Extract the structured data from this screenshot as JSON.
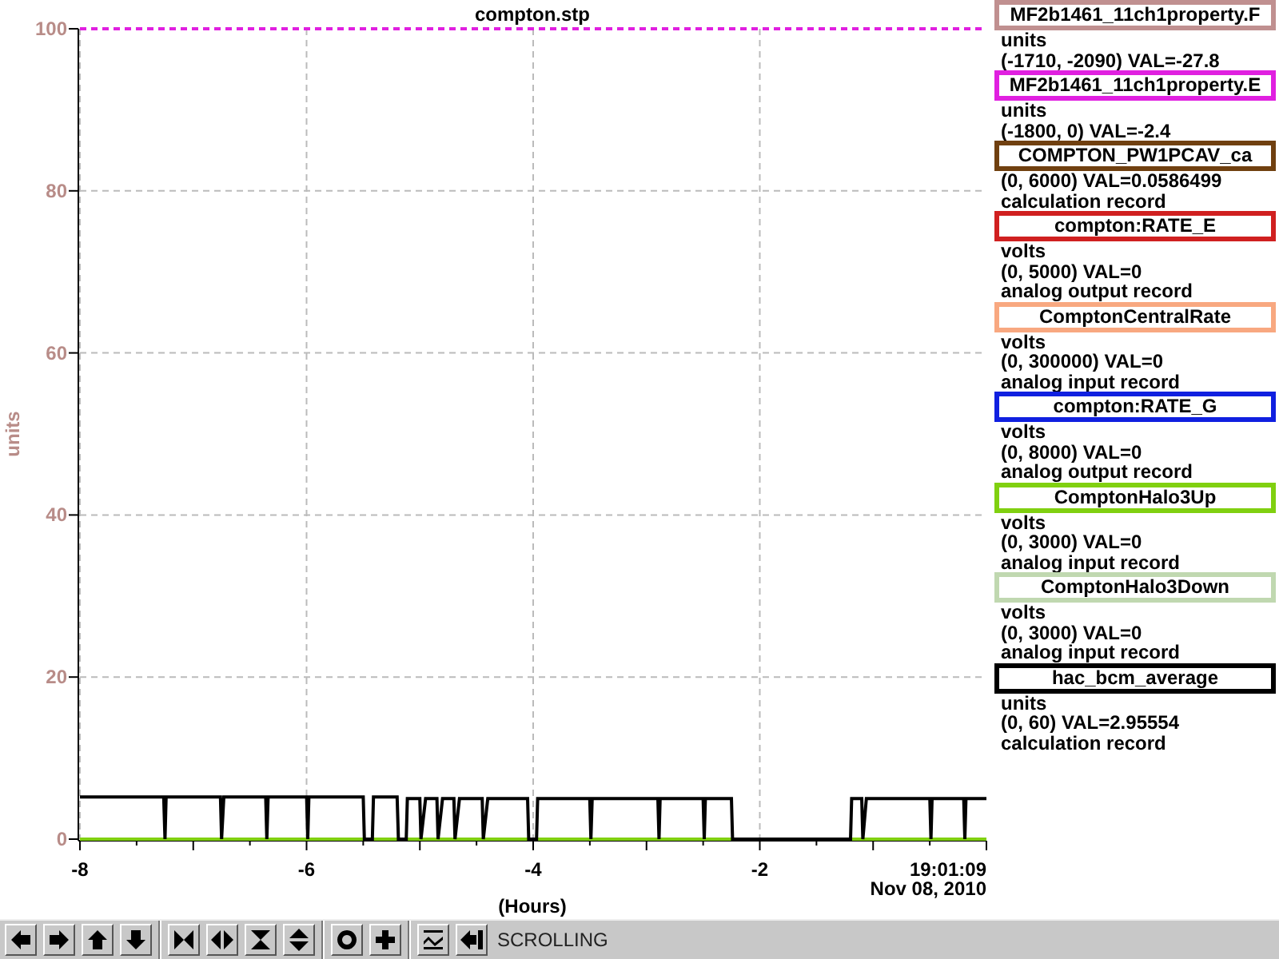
{
  "chart": {
    "title": "compton.stp",
    "y_axis_label": "units",
    "end_time": "19:01:09",
    "end_date": "Nov 08, 2010",
    "chart_data": {
      "type": "line",
      "grid": true,
      "xlabel": "(Hours)",
      "xlim": [
        -8,
        0
      ],
      "ylim": [
        0,
        100
      ],
      "xticks": [
        -8,
        -6,
        -4,
        -2
      ],
      "yticks": [
        0,
        20,
        40,
        60,
        80,
        100
      ],
      "series": [
        {
          "color": "#e020e0",
          "line_style": "dashed",
          "x": [
            -8,
            0
          ],
          "values": [
            100,
            100
          ]
        },
        {
          "color": "#80d010",
          "line_style": "solid",
          "x": [
            -8,
            0
          ],
          "values": [
            0,
            0
          ]
        },
        {
          "color": "#000000",
          "line_style": "solid",
          "x": [
            -8,
            -7.26,
            -7.25,
            -7.24,
            -6.76,
            -6.75,
            -6.73,
            -6.36,
            -6.35,
            -6.34,
            -6,
            -5.99,
            -5.98,
            -5.5,
            -5.49,
            -5.42,
            -5.41,
            -5.2,
            -5.19,
            -5.12,
            -5.11,
            -5,
            -4.99,
            -4.95,
            -4.85,
            -4.84,
            -4.8,
            -4.7,
            -4.69,
            -4.65,
            -4.45,
            -4.44,
            -4.4,
            -4.05,
            -4.04,
            -3.97,
            -3.96,
            -3.5,
            -3.49,
            -3.48,
            -2.9,
            -2.89,
            -2.88,
            -2.5,
            -2.49,
            -2.48,
            -2.25,
            -2.24,
            -1.2,
            -1.19,
            -1.1,
            -1.09,
            -1.06,
            -0.5,
            -0.49,
            -0.48,
            -0.2,
            -0.19,
            -0.18,
            0
          ],
          "values": [
            5.2,
            5.2,
            0,
            5.2,
            5.2,
            0,
            5.2,
            5.2,
            0,
            5.2,
            5.2,
            0,
            5.2,
            5.2,
            0,
            0,
            5.2,
            5.2,
            0,
            0,
            5,
            5,
            0,
            5,
            5,
            0,
            5,
            5,
            0,
            5,
            5,
            0,
            5,
            5,
            0,
            0,
            5,
            5,
            0,
            5,
            5,
            0,
            5,
            5,
            0,
            5,
            5,
            0,
            0,
            5,
            5,
            0,
            5,
            5,
            0,
            5,
            5,
            0,
            5,
            5
          ]
        }
      ]
    }
  },
  "legend": {
    "items": [
      {
        "name": "MF2b1461_11ch1property.F",
        "color": "#c09090",
        "lines": [
          "units",
          "(-1710, -2090) VAL=-27.8"
        ]
      },
      {
        "name": "MF2b1461_11ch1property.E",
        "color": "#e020e0",
        "lines": [
          "units",
          "(-1800, 0) VAL=-2.4"
        ]
      },
      {
        "name": "COMPTON_PW1PCAV_ca",
        "color": "#704010",
        "lines": [
          "(0, 6000) VAL=0.0586499",
          "calculation record"
        ]
      },
      {
        "name": "compton:RATE_E",
        "color": "#d02020",
        "lines": [
          "volts",
          "(0, 5000) VAL=0",
          "analog output record"
        ]
      },
      {
        "name": "ComptonCentralRate",
        "color": "#f8a880",
        "lines": [
          "volts",
          "(0, 300000) VAL=0",
          "analog input record"
        ]
      },
      {
        "name": "compton:RATE_G",
        "color": "#1020e0",
        "lines": [
          "volts",
          "(0, 8000) VAL=0",
          "analog output record"
        ]
      },
      {
        "name": "ComptonHalo3Up",
        "color": "#80d010",
        "lines": [
          "volts",
          "(0, 3000) VAL=0",
          "analog input record"
        ]
      },
      {
        "name": "ComptonHalo3Down",
        "color": "#c0d8b0",
        "lines": [
          "volts",
          "(0, 3000) VAL=0",
          "analog input record"
        ]
      },
      {
        "name": "hac_bcm_average",
        "color": "#000000",
        "lines": [
          "units",
          "(0, 60) VAL=2.95554",
          "calculation record"
        ]
      }
    ]
  },
  "toolbar": {
    "buttons": [
      {
        "kind": "left"
      },
      {
        "kind": "right"
      },
      {
        "kind": "up"
      },
      {
        "kind": "down"
      },
      {
        "kind": "zoom-in-x"
      },
      {
        "kind": "zoom-out-x"
      },
      {
        "kind": "zoom-in-y"
      },
      {
        "kind": "zoom-out-y"
      },
      {
        "kind": "circle"
      },
      {
        "kind": "plus"
      },
      {
        "kind": "graph"
      },
      {
        "kind": "back"
      }
    ],
    "status": "SCROLLING"
  }
}
